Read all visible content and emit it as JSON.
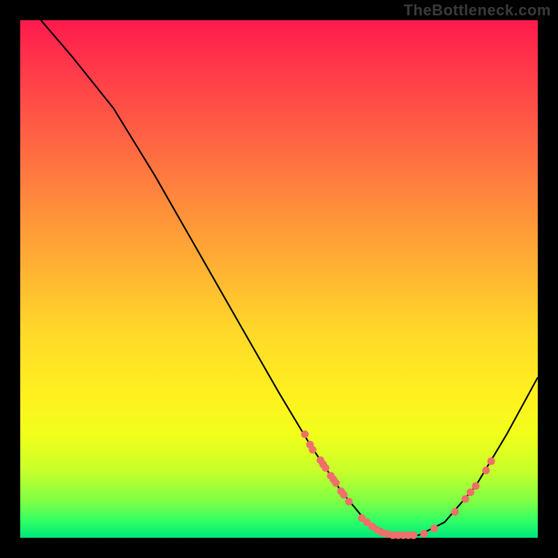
{
  "watermark": "TheBottleneck.com",
  "chart_data": {
    "type": "line",
    "title": "",
    "xlabel": "",
    "ylabel": "",
    "xlim": [
      0,
      100
    ],
    "ylim": [
      0,
      100
    ],
    "curve": [
      {
        "x": 4,
        "y": 100
      },
      {
        "x": 10,
        "y": 93
      },
      {
        "x": 18,
        "y": 83
      },
      {
        "x": 26,
        "y": 70
      },
      {
        "x": 34,
        "y": 56
      },
      {
        "x": 42,
        "y": 42
      },
      {
        "x": 50,
        "y": 28
      },
      {
        "x": 56,
        "y": 18
      },
      {
        "x": 62,
        "y": 9
      },
      {
        "x": 67,
        "y": 3
      },
      {
        "x": 72,
        "y": 0.5
      },
      {
        "x": 77,
        "y": 0.5
      },
      {
        "x": 82,
        "y": 3
      },
      {
        "x": 88,
        "y": 10
      },
      {
        "x": 94,
        "y": 20
      },
      {
        "x": 100,
        "y": 31
      }
    ],
    "markers": [
      {
        "x": 55,
        "y": 20
      },
      {
        "x": 56,
        "y": 18
      },
      {
        "x": 56.5,
        "y": 17
      },
      {
        "x": 58,
        "y": 15
      },
      {
        "x": 58.5,
        "y": 14.2
      },
      {
        "x": 59,
        "y": 13.5
      },
      {
        "x": 60,
        "y": 12
      },
      {
        "x": 60.5,
        "y": 11.3
      },
      {
        "x": 61,
        "y": 10.6
      },
      {
        "x": 62,
        "y": 9
      },
      {
        "x": 62.5,
        "y": 8.3
      },
      {
        "x": 63.5,
        "y": 7
      },
      {
        "x": 66,
        "y": 3.8
      },
      {
        "x": 67,
        "y": 3
      },
      {
        "x": 68,
        "y": 2.2
      },
      {
        "x": 69,
        "y": 1.5
      },
      {
        "x": 70,
        "y": 1
      },
      {
        "x": 71,
        "y": 0.7
      },
      {
        "x": 72,
        "y": 0.5
      },
      {
        "x": 73,
        "y": 0.5
      },
      {
        "x": 74,
        "y": 0.5
      },
      {
        "x": 75,
        "y": 0.5
      },
      {
        "x": 76,
        "y": 0.5
      },
      {
        "x": 78,
        "y": 0.8
      },
      {
        "x": 80,
        "y": 1.8
      },
      {
        "x": 84,
        "y": 5
      },
      {
        "x": 86,
        "y": 7.5
      },
      {
        "x": 87,
        "y": 8.8
      },
      {
        "x": 88,
        "y": 10
      },
      {
        "x": 90,
        "y": 13
      },
      {
        "x": 91,
        "y": 14.8
      }
    ],
    "colors": {
      "curve": "#000000",
      "marker": "#ef6f6a"
    }
  }
}
